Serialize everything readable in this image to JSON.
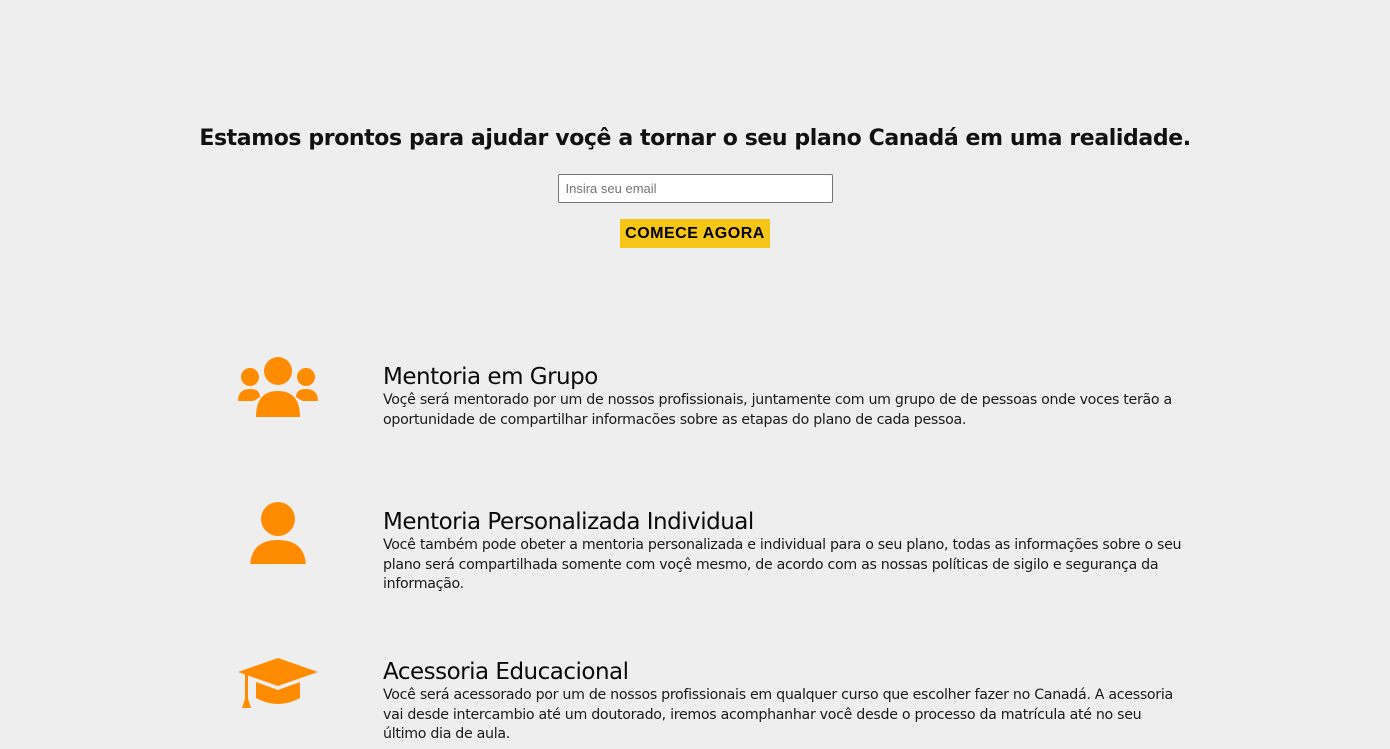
{
  "hero": {
    "title": "Estamos prontos para ajudar voçê a tornar o seu plano Canadá em uma realidade.",
    "email_placeholder": "Insira seu email",
    "email_value": "",
    "button_label": "COMECE AGORA",
    "button_color": "#f5c518"
  },
  "colors": {
    "background": "#eeeeee",
    "icon": "#ff8c00"
  },
  "services": [
    {
      "icon": "group-icon",
      "title": "Mentoria em Grupo",
      "description": "Voçê será mentorado por um de nossos profissionais, juntamente com um grupo de de pessoas onde voces terão a oportunidade de compartilhar informacões sobre as etapas do plano de cada pessoa."
    },
    {
      "icon": "user-icon",
      "title": "Mentoria Personalizada Individual",
      "description": "Você também pode obeter a mentoria personalizada e individual para o seu plano, todas as informações sobre o seu plano será compartilhada somente com voçê mesmo, de acordo com as nossas políticas de sigilo e segurança da informação."
    },
    {
      "icon": "graduation-cap-icon",
      "title": "Acessoria Educacional",
      "description": "Você será acessorado por um de nossos profissionais em qualquer curso que escolher fazer no Canadá. A acessoria vai desde intercambio até um doutorado, iremos acomphanhar você desde o processo da matrícula até no seu último dia de aula."
    }
  ]
}
